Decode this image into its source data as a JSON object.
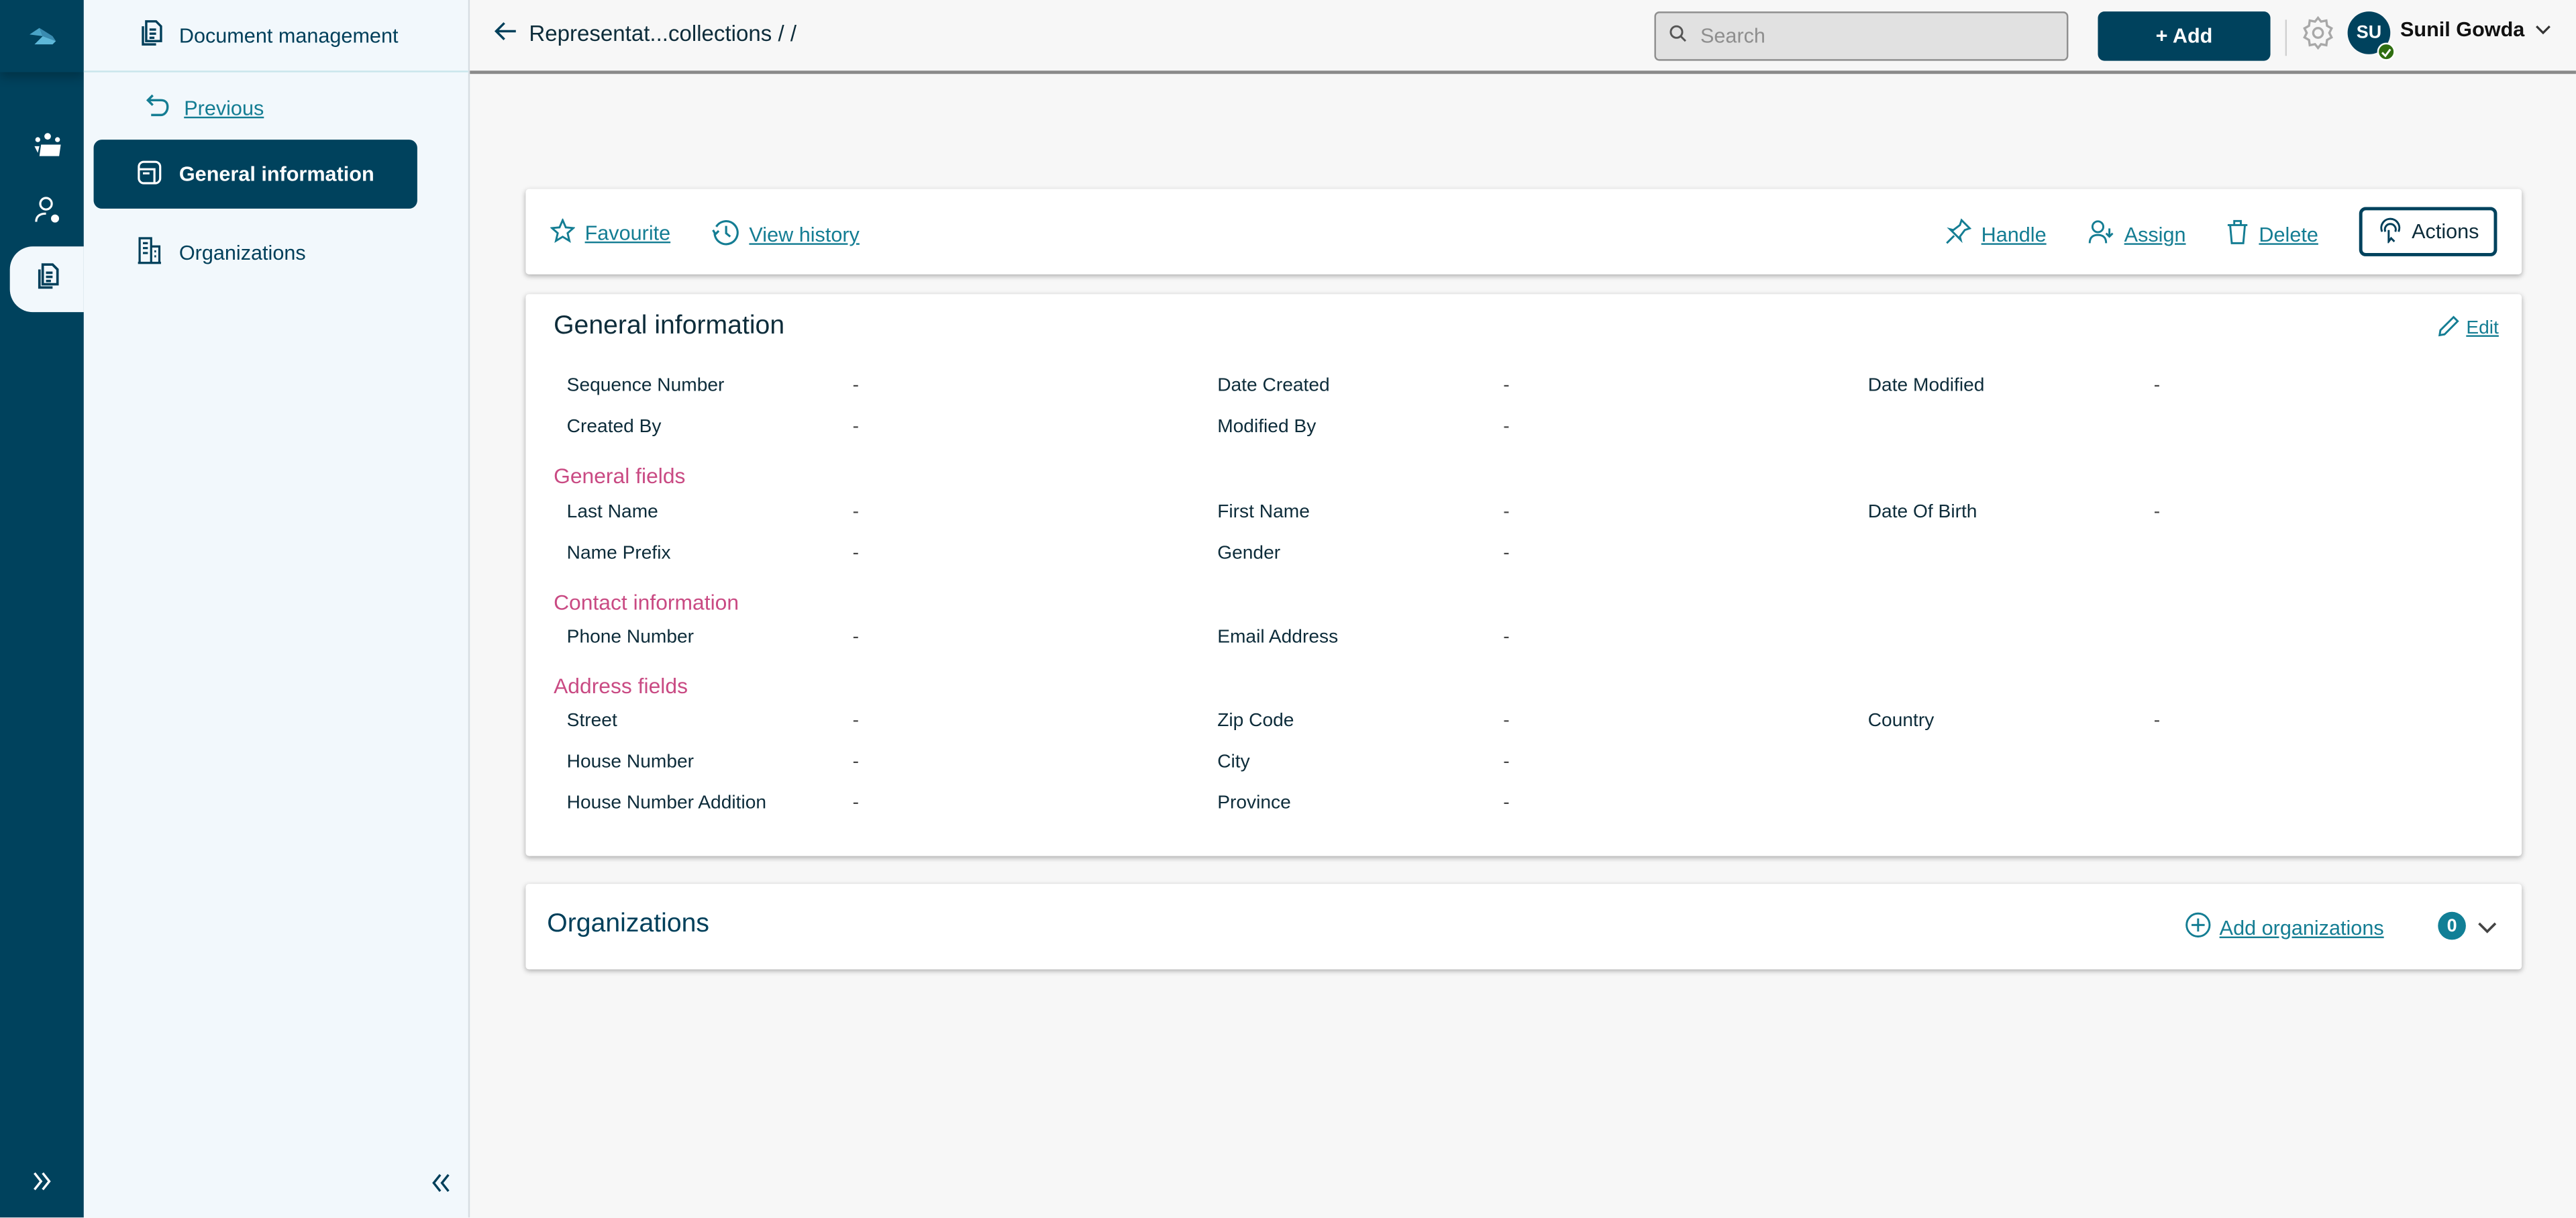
{
  "rail": {
    "items": [
      {
        "icon": "logo-icon"
      },
      {
        "icon": "team-workspace-icon"
      },
      {
        "icon": "user-settings-icon"
      },
      {
        "icon": "documents-icon",
        "active": true
      }
    ],
    "expand_icon": "double-chevron-right-icon"
  },
  "subnav": {
    "header": "Document management",
    "previous": "Previous",
    "items": [
      {
        "label": "General information",
        "icon": "form-icon",
        "active": true
      },
      {
        "label": "Organizations",
        "icon": "building-icon",
        "active": false
      }
    ],
    "collapse_icon": "double-chevron-left-icon"
  },
  "topbar": {
    "breadcrumb": "Representat...collections / /",
    "search_placeholder": "Search",
    "search_value": "",
    "add_label": "+ Add",
    "user": {
      "initials": "SU",
      "name": "Sunil Gowda",
      "status": "online"
    }
  },
  "actionbar": {
    "favourite": "Favourite",
    "view_history": "View history",
    "handle": "Handle",
    "assign": "Assign",
    "delete": "Delete",
    "actions": "Actions"
  },
  "general": {
    "title": "General information",
    "edit": "Edit",
    "meta_fields": [
      {
        "label": "Sequence Number",
        "value": "-"
      },
      {
        "label": "Date Created",
        "value": "-"
      },
      {
        "label": "Date Modified",
        "value": "-"
      },
      {
        "label": "Created By",
        "value": "-"
      },
      {
        "label": "Modified By",
        "value": "-"
      }
    ],
    "sections": [
      {
        "title": "General fields",
        "fields": [
          {
            "label": "Last Name",
            "value": "-"
          },
          {
            "label": "First Name",
            "value": "-"
          },
          {
            "label": "Date Of Birth",
            "value": "-"
          },
          {
            "label": "Name Prefix",
            "value": "-"
          },
          {
            "label": "Gender",
            "value": "-"
          }
        ]
      },
      {
        "title": "Contact information",
        "fields": [
          {
            "label": "Phone Number",
            "value": "-"
          },
          {
            "label": "Email Address",
            "value": "-"
          }
        ]
      },
      {
        "title": "Address fields",
        "fields": [
          {
            "label": "Street",
            "value": "-"
          },
          {
            "label": "Zip Code",
            "value": "-"
          },
          {
            "label": "Country",
            "value": "-"
          },
          {
            "label": "House Number",
            "value": "-"
          },
          {
            "label": "City",
            "value": "-"
          },
          {
            "label": "House Number Addition",
            "value": "-"
          },
          {
            "label": "Province",
            "value": "-"
          }
        ]
      }
    ]
  },
  "organizations": {
    "title": "Organizations",
    "add_label": "Add organizations",
    "count": "0"
  },
  "colors": {
    "primary": "#00425d",
    "link": "#147d93",
    "section": "#c94a83",
    "badge": "#117f96",
    "status_ok": "#2f6e10"
  }
}
